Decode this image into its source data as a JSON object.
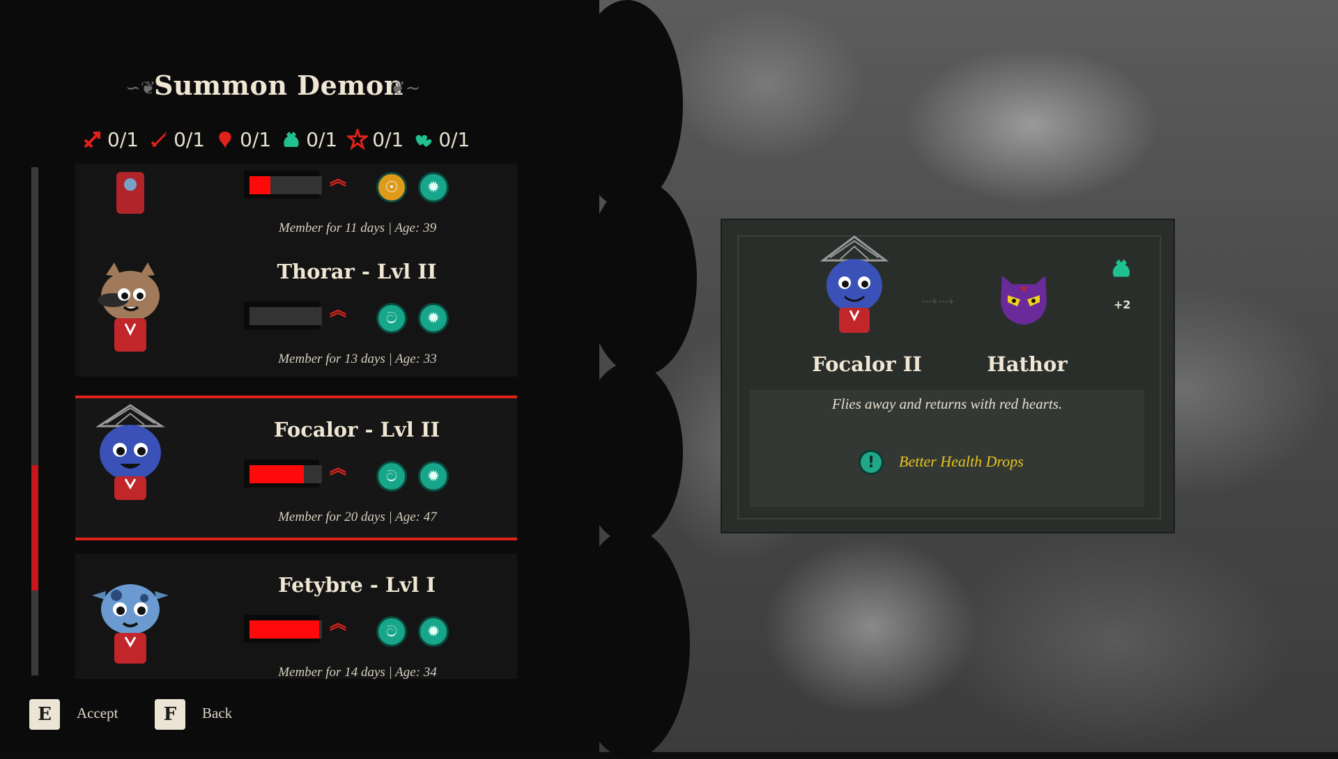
{
  "header": {
    "title": "Summon Demon"
  },
  "counters": [
    {
      "icon": "red-arrows-icon",
      "value": "0/1",
      "color": "#e0221a"
    },
    {
      "icon": "red-sword-icon",
      "value": "0/1",
      "color": "#e0221a"
    },
    {
      "icon": "red-heart-drop-icon",
      "value": "0/1",
      "color": "#e0221a"
    },
    {
      "icon": "green-pouch-icon",
      "value": "0/1",
      "color": "#20c090"
    },
    {
      "icon": "red-star-burst-icon",
      "value": "0/1",
      "color": "#e0221a"
    },
    {
      "icon": "green-hearts-icon",
      "value": "0/1",
      "color": "#20c090"
    }
  ],
  "followers": [
    {
      "name": "",
      "level_fill": 0.3,
      "info": "Member for 11 days | Age: 39"
    },
    {
      "name": "Thorar - Lvl II",
      "level_fill": 0.0,
      "info": "Member for 13 days | Age: 33"
    },
    {
      "name": "Focalor - Lvl II",
      "level_fill": 0.7,
      "info": "Member for 20 days | Age: 47",
      "selected": true
    },
    {
      "name": "Fetybre - Lvl I",
      "level_fill": 0.95,
      "info": "Member for 14 days | Age: 34"
    }
  ],
  "scroll_position": 0.6,
  "footer": {
    "accept_key": "E",
    "accept_label": "Accept",
    "back_key": "F",
    "back_label": "Back"
  },
  "detail": {
    "follower_name": "Focalor II",
    "demon_name": "Hathor",
    "description": "Flies away and returns with red hearts.",
    "bonus": "Better Health Drops",
    "bonus_count": "+2"
  },
  "colors": {
    "accent_red": "#e0221a",
    "trait_green": "#17a68a",
    "bonus_yellow": "#e8c51a"
  }
}
